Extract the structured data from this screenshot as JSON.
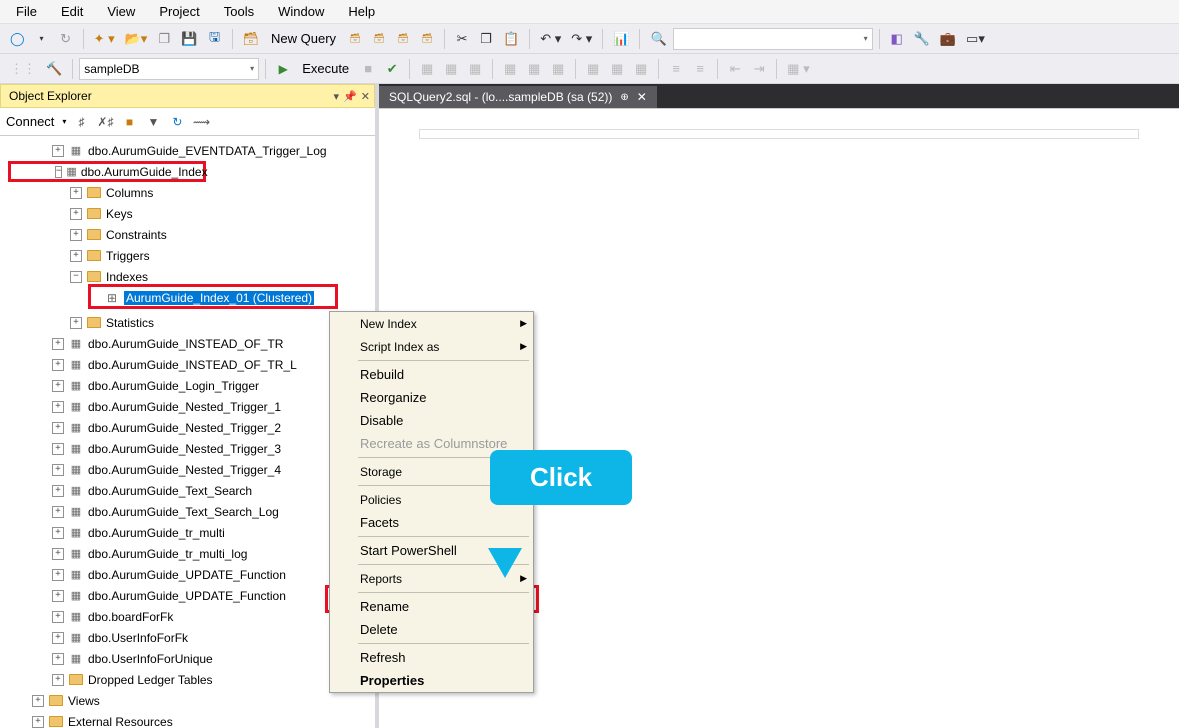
{
  "menu": {
    "items": [
      "File",
      "Edit",
      "View",
      "Project",
      "Tools",
      "Window",
      "Help"
    ]
  },
  "toolbar1": {
    "new_query": "New Query",
    "icons": [
      "MDX",
      "DMX",
      "XMLA",
      "DAX"
    ]
  },
  "toolbar2": {
    "db": "sampleDB",
    "execute": "Execute"
  },
  "panel": {
    "title": "Object Explorer",
    "connect": "Connect"
  },
  "tree": {
    "t0": "dbo.AurumGuide_EVENTDATA_Trigger_Log",
    "t1": "dbo.AurumGuide_Index",
    "columns": "Columns",
    "keys": "Keys",
    "constraints": "Constraints",
    "triggers": "Triggers",
    "indexes": "Indexes",
    "index_sel": "AurumGuide_Index_01 (Clustered)",
    "statistics": "Statistics",
    "t2": "dbo.AurumGuide_INSTEAD_OF_TR",
    "t3": "dbo.AurumGuide_INSTEAD_OF_TR_L",
    "t4": "dbo.AurumGuide_Login_Trigger",
    "t5": "dbo.AurumGuide_Nested_Trigger_1",
    "t6": "dbo.AurumGuide_Nested_Trigger_2",
    "t7": "dbo.AurumGuide_Nested_Trigger_3",
    "t8": "dbo.AurumGuide_Nested_Trigger_4",
    "t9": "dbo.AurumGuide_Text_Search",
    "t10": "dbo.AurumGuide_Text_Search_Log",
    "t11": "dbo.AurumGuide_tr_multi",
    "t12": "dbo.AurumGuide_tr_multi_log",
    "t13": "dbo.AurumGuide_UPDATE_Function",
    "t14": "dbo.AurumGuide_UPDATE_Function",
    "t15": "dbo.boardForFk",
    "t16": "dbo.UserInfoForFk",
    "t17": "dbo.UserInfoForUnique",
    "dropped": "Dropped Ledger Tables",
    "views": "Views",
    "external": "External Resources"
  },
  "tab": {
    "title": "SQLQuery2.sql - (lo....sampleDB (sa (52))"
  },
  "ctx": {
    "new_index": "New Index",
    "script": "Script Index as",
    "rebuild": "Rebuild",
    "reorganize": "Reorganize",
    "disable": "Disable",
    "recreate": "Recreate as Columnstore",
    "storage": "Storage",
    "policies": "Policies",
    "facets": "Facets",
    "powershell": "Start PowerShell",
    "reports": "Reports",
    "rename": "Rename",
    "delete": "Delete",
    "refresh": "Refresh",
    "properties": "Properties"
  },
  "callout": {
    "text": "Click"
  }
}
